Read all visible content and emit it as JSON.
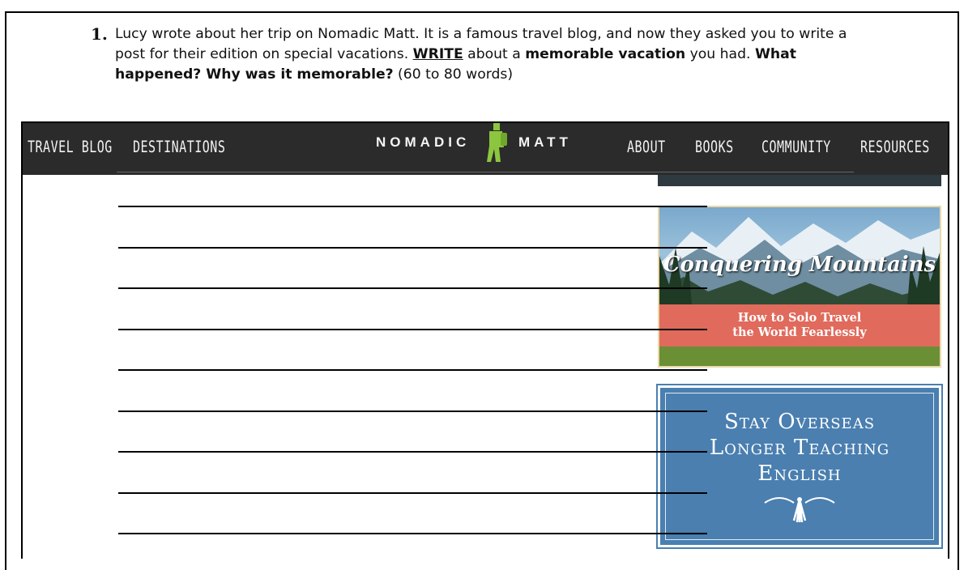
{
  "question": {
    "number": "1.",
    "part1": "Lucy wrote about her trip on Nomadic Matt. It is a famous travel blog, and now they asked you to write a post for their edition on special vacations. ",
    "write_word": "WRITE",
    "part2": " about a ",
    "memorable_vacation": "memorable vacation",
    "part3": " you had. ",
    "prompt_bold": "What happened? Why was it memorable?",
    "word_count": " (60 to 80 words)"
  },
  "nav": {
    "items": [
      "TRAVEL BLOG",
      "DESTINATIONS",
      "ABOUT",
      "BOOKS",
      "COMMUNITY",
      "RESOURCES"
    ],
    "logo_left": "NOMADIC",
    "logo_right": "MATT"
  },
  "writing_lines": 9,
  "ads": {
    "mountains": {
      "title": "Conquering Mountains",
      "banner_line1": "How to Solo Travel",
      "banner_line2": "the World Fearlessly"
    },
    "teaching": {
      "line1": "Stay Overseas",
      "line2": "Longer Teaching",
      "line3": "English"
    }
  },
  "colors": {
    "nav_bg": "#2b2b2b",
    "logo_accent": "#8cc63f",
    "banner_red": "#e06a5c",
    "ad_blue": "#4a7fb0"
  }
}
